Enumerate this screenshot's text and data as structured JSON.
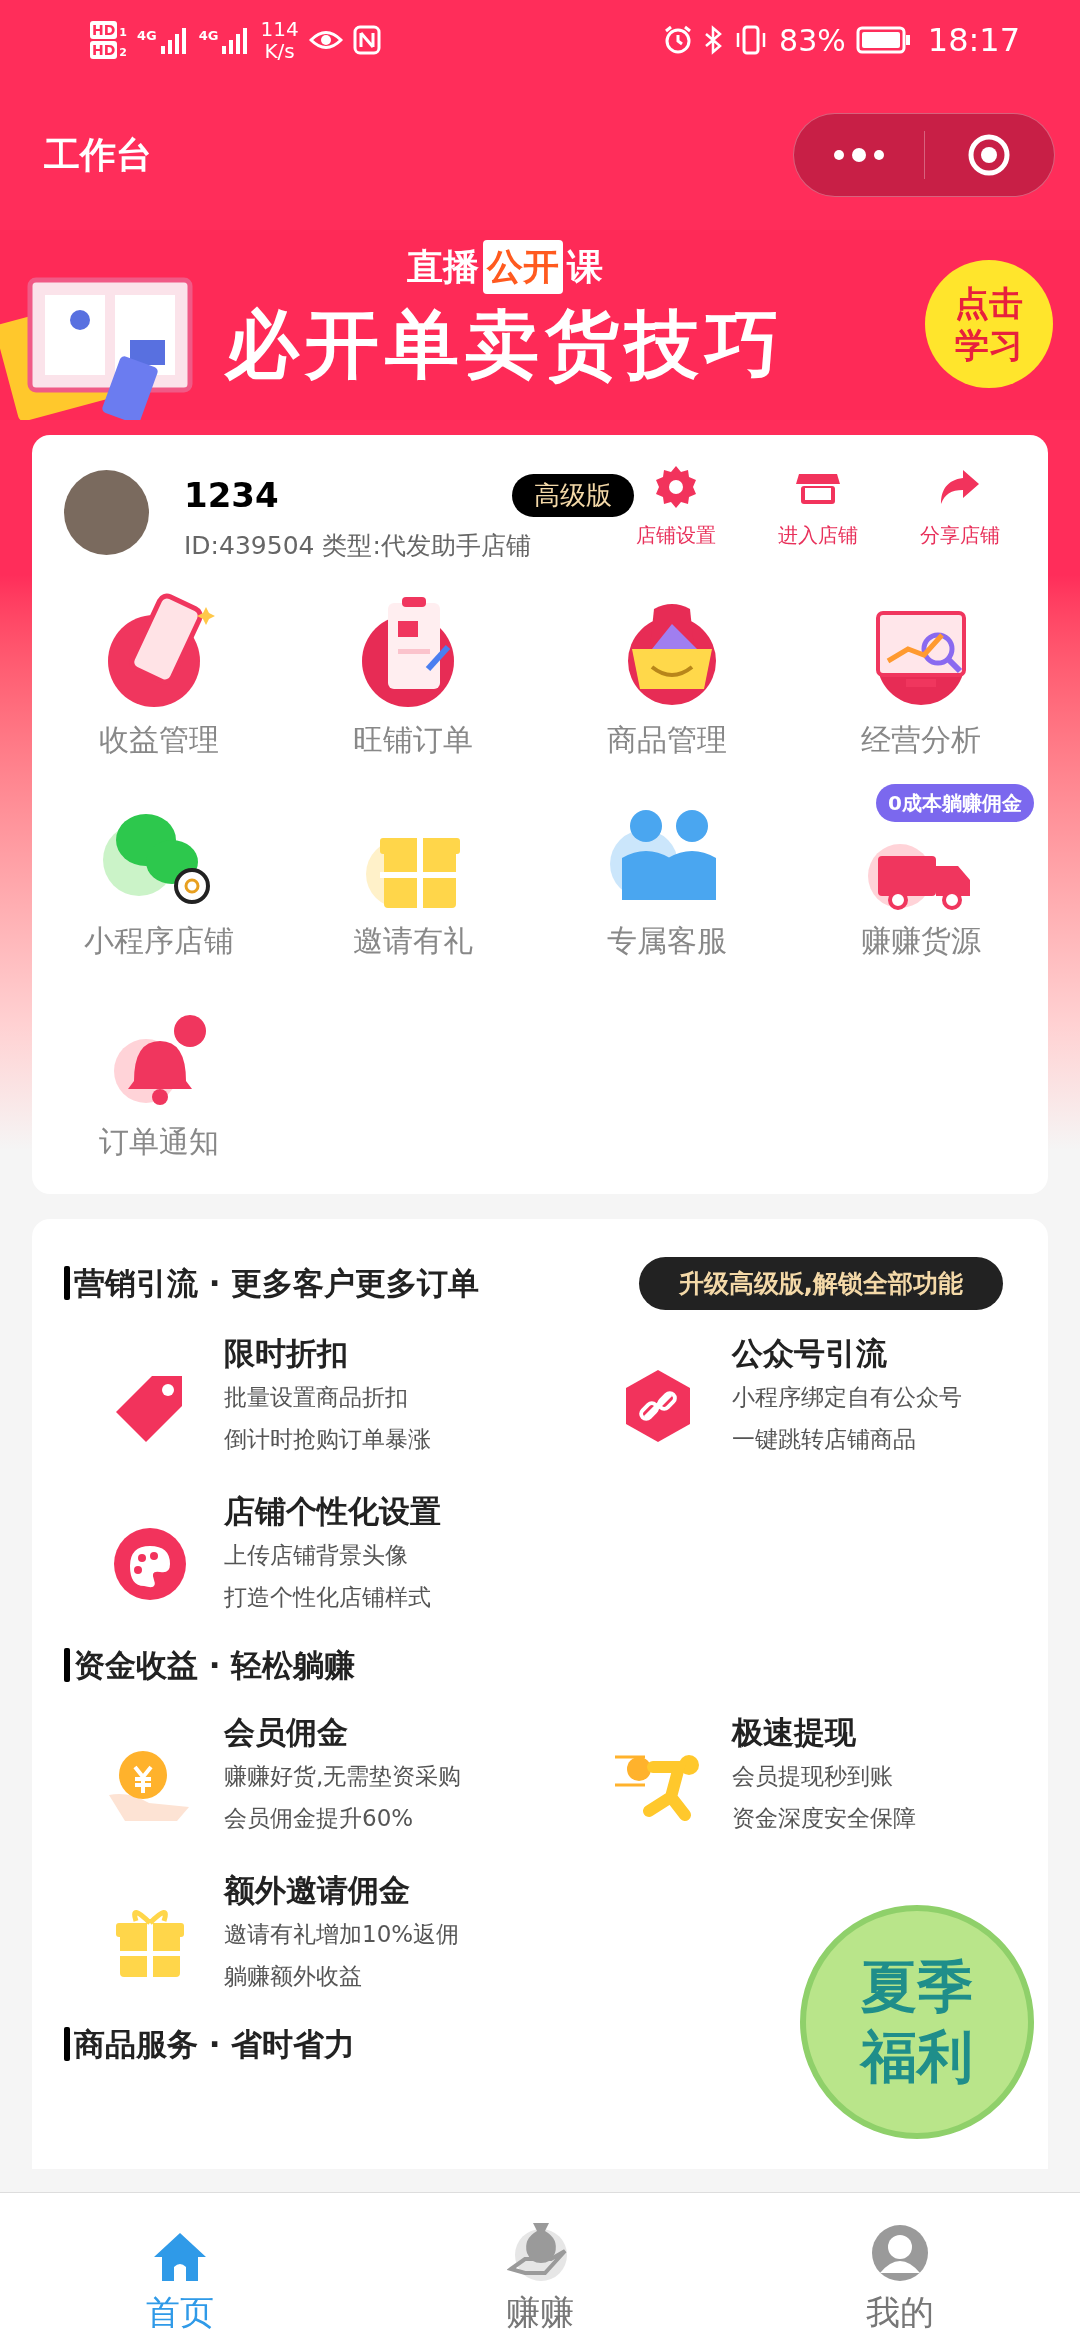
{
  "status_bar": {
    "sim": [
      {
        "label": "HD",
        "index": "1"
      },
      {
        "label": "HD",
        "index": "2"
      }
    ],
    "network": [
      "4G",
      "4G"
    ],
    "speed": "114",
    "speed_unit": "K/s",
    "battery": "83%",
    "time": "18:17"
  },
  "header": {
    "title": "工作台"
  },
  "banner": {
    "kicker_a": "直播",
    "kicker_b": "公开",
    "kicker_c": "课",
    "headline": "必开单卖货技巧",
    "cta": [
      "点击",
      "学习"
    ]
  },
  "profile": {
    "name": "1234",
    "plan": "高级版",
    "info": "ID:439504 类型:代发助手店铺",
    "actions": [
      "店铺设置",
      "进入店铺",
      "分享店铺"
    ]
  },
  "grid": [
    {
      "label": "收益管理"
    },
    {
      "label": "旺铺订单"
    },
    {
      "label": "商品管理"
    },
    {
      "label": "经营分析"
    },
    {
      "label": "小程序店铺"
    },
    {
      "label": "邀请有礼"
    },
    {
      "label": "专属客服"
    },
    {
      "label": "赚赚货源",
      "badge": "0成本躺赚佣金"
    },
    {
      "label": "订单通知"
    }
  ],
  "sections": [
    {
      "title": "营销引流 · 更多客户更多订单",
      "upgrade": "升级高级版,解锁全部功能",
      "items": [
        {
          "title": "限时折扣",
          "lines": [
            "批量设置商品折扣",
            "倒计时抢购订单暴涨"
          ]
        },
        {
          "title": "公众号引流",
          "lines": [
            "小程序绑定自有公众号",
            "一键跳转店铺商品"
          ]
        },
        {
          "title": "店铺个性化设置",
          "lines": [
            "上传店铺背景头像",
            "打造个性化店铺样式"
          ]
        }
      ]
    },
    {
      "title": "资金收益 · 轻松躺赚",
      "items": [
        {
          "title": "会员佣金",
          "lines": [
            "赚赚好货,无需垫资采购",
            "会员佣金提升60%"
          ]
        },
        {
          "title": "极速提现",
          "lines": [
            "会员提现秒到账",
            "资金深度安全保障"
          ]
        },
        {
          "title": "额外邀请佣金",
          "lines": [
            "邀请有礼增加10%返佣",
            "躺赚额外收益"
          ]
        }
      ]
    },
    {
      "title": "商品服务 · 省时省力"
    }
  ],
  "promo": {
    "lines": [
      "夏季",
      "福利"
    ]
  },
  "tabs": [
    {
      "label": "首页",
      "selected": true
    },
    {
      "label": "赚赚",
      "selected": false
    },
    {
      "label": "我的",
      "selected": false
    }
  ]
}
